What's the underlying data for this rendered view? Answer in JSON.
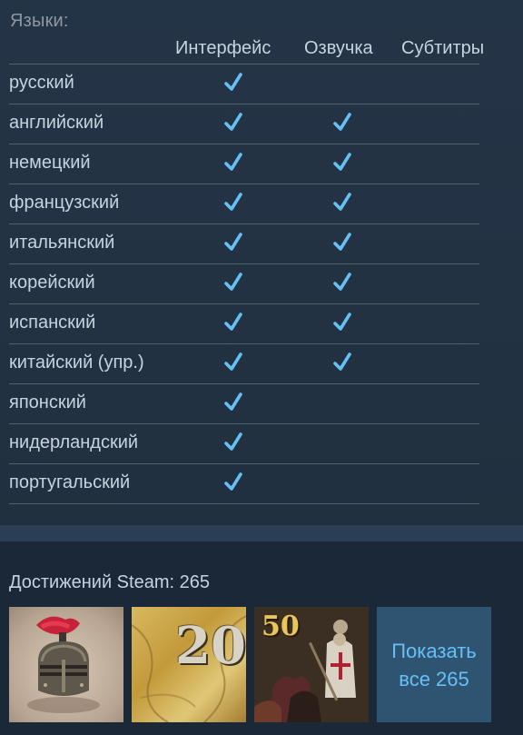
{
  "languages": {
    "title": "Языки:",
    "columns": {
      "interface": "Интерфейс",
      "audio": "Озвучка",
      "subtitles": "Субтитры"
    },
    "rows": [
      {
        "name": "русский",
        "interface": true,
        "audio": false,
        "subtitles": false
      },
      {
        "name": "английский",
        "interface": true,
        "audio": true,
        "subtitles": false
      },
      {
        "name": "немецкий",
        "interface": true,
        "audio": true,
        "subtitles": false
      },
      {
        "name": "французский",
        "interface": true,
        "audio": true,
        "subtitles": false
      },
      {
        "name": "итальянский",
        "interface": true,
        "audio": true,
        "subtitles": false
      },
      {
        "name": "корейский",
        "interface": true,
        "audio": true,
        "subtitles": false
      },
      {
        "name": "испанский",
        "interface": true,
        "audio": true,
        "subtitles": false
      },
      {
        "name": "китайский (упр.)",
        "interface": true,
        "audio": true,
        "subtitles": false
      },
      {
        "name": "японский",
        "interface": true,
        "audio": false,
        "subtitles": false
      },
      {
        "name": "нидерландский",
        "interface": true,
        "audio": false,
        "subtitles": false
      },
      {
        "name": "португальский",
        "interface": true,
        "audio": false,
        "subtitles": false
      }
    ],
    "check_icon": "checkmark-icon",
    "check_color": "#66c0f4"
  },
  "achievements": {
    "title": "Достижений Steam: 265",
    "items": [
      {
        "icon": "knight-helmet-icon",
        "label": ""
      },
      {
        "icon": "map-badge-icon",
        "label": "20"
      },
      {
        "icon": "battle-scene-icon",
        "label": "50"
      }
    ],
    "show_all_line1": "Показать",
    "show_all_line2": "все 265"
  }
}
